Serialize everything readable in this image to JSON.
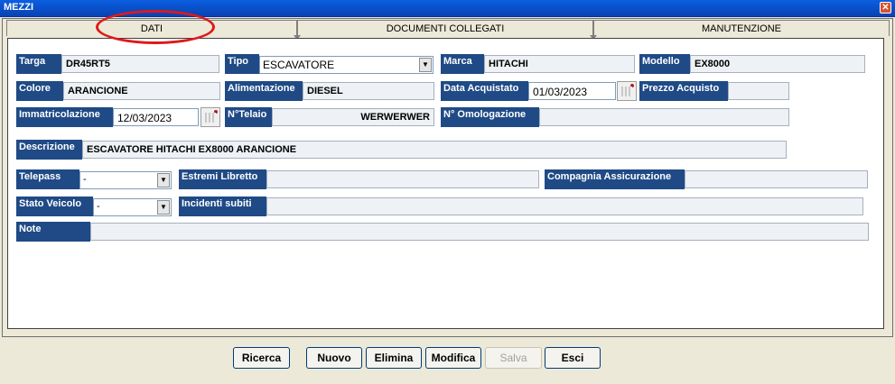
{
  "window": {
    "title": "MEZZI",
    "close": "✕"
  },
  "tabs": [
    {
      "label": "DATI",
      "active": true
    },
    {
      "label": "DOCUMENTI COLLEGATI",
      "active": false
    },
    {
      "label": "MANUTENZIONE",
      "active": false
    }
  ],
  "form": {
    "targa": {
      "label": "Targa",
      "value": "DR45RT5"
    },
    "tipo": {
      "label": "Tipo",
      "value": "ESCAVATORE"
    },
    "marca": {
      "label": "Marca",
      "value": "HITACHI"
    },
    "modello": {
      "label": "Modello",
      "value": "EX8000"
    },
    "colore": {
      "label": "Colore",
      "value": "ARANCIONE"
    },
    "alimentazione": {
      "label": "Alimentazione",
      "value": "DIESEL"
    },
    "data_acquistato": {
      "label": "Data Acquistato",
      "value": "01/03/2023"
    },
    "prezzo_acquisto": {
      "label": "Prezzo Acquisto",
      "value": ""
    },
    "immatricolazione": {
      "label": "Immatricolazione",
      "value": "12/03/2023"
    },
    "n_telaio": {
      "label": "N°Telaio",
      "value": "WERWERWER"
    },
    "n_omologazione": {
      "label": "N° Omologazione",
      "value": ""
    },
    "descrizione": {
      "label": "Descrizione",
      "value": "ESCAVATORE HITACHI EX8000 ARANCIONE"
    },
    "telepass": {
      "label": "Telepass",
      "value": "-"
    },
    "estremi_libretto": {
      "label": "Estremi Libretto",
      "value": ""
    },
    "compagnia_assicurazione": {
      "label": "Compagnia Assicurazione",
      "value": ""
    },
    "stato_veicolo": {
      "label": "Stato Veicolo",
      "value": "-"
    },
    "incidenti_subiti": {
      "label": "Incidenti subiti",
      "value": ""
    },
    "note": {
      "label": "Note",
      "value": ""
    }
  },
  "buttons": {
    "ricerca": "Ricerca",
    "nuovo": "Nuovo",
    "elimina": "Elimina",
    "modifica": "Modifica",
    "salva": "Salva",
    "esci": "Esci"
  }
}
